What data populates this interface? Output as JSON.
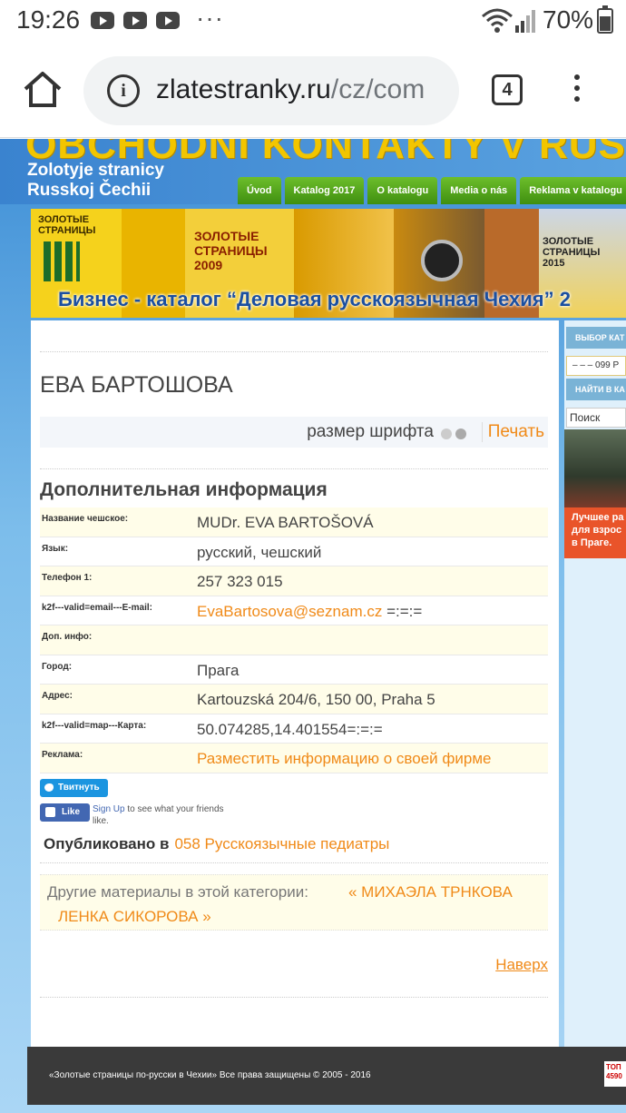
{
  "statusbar": {
    "time": "19:26",
    "notifications": [
      "youtube-icon",
      "youtube-icon",
      "youtube-icon"
    ],
    "more": "···",
    "battery": "70%"
  },
  "browser": {
    "url_domain": "zlatestranky.ru",
    "url_path": "/cz/com",
    "tab_count": "4"
  },
  "site": {
    "header_title": "OBCHODNÍ KONTAKTY V RUSTINĚ V",
    "subtitle_line1": "Zolotyje stranicy",
    "subtitle_line2": "Russkoj Čechii",
    "nav": [
      "Úvod",
      "Katalog 2017",
      "O katalogu",
      "Media o nás",
      "Reklama v katalogu"
    ],
    "banner_text": "Бизнес - каталог “Деловая русскоязычная Чехия” 2",
    "banner_book_labels": [
      "ЗОЛОТЫЕ СТРАНИЦЫ",
      "ЗОЛОТЫЕ СТРАНИЦЫ 2009",
      "ЗОЛОТЫЕ СТРАНИЦЫ 2015"
    ]
  },
  "article": {
    "title": "ЕВА БАРТОШОВА",
    "font_size_label": "размер шрифта",
    "print_label": "Печать",
    "section_title": "Дополнительная информация",
    "fields": [
      {
        "label": "Название чешское:",
        "value": "MUDr. EVA BARTOŠOVÁ",
        "link": false,
        "suffix": ""
      },
      {
        "label": "Язык:",
        "value": "русский, чешский",
        "link": false,
        "suffix": ""
      },
      {
        "label": "Телефон 1:",
        "value": "257 323 015",
        "link": false,
        "suffix": ""
      },
      {
        "label": "k2f---valid=email---E-mail:",
        "value": "EvaBartosova@seznam.cz",
        "link": true,
        "suffix": " =:=:="
      },
      {
        "label": "Доп. инфо:",
        "value": "",
        "link": false,
        "suffix": ""
      },
      {
        "label": "Город:",
        "value": "Прага",
        "link": false,
        "suffix": ""
      },
      {
        "label": "Адрес:",
        "value": "Kartouzská 204/6, 150 00, Praha 5",
        "link": false,
        "suffix": ""
      },
      {
        "label": "k2f---valid=map---Карта:",
        "value": "50.074285,14.401554=:=:=",
        "link": false,
        "suffix": ""
      },
      {
        "label": "Реклама:",
        "value": "Разместить информацию о своей фирме",
        "link": true,
        "suffix": ""
      }
    ],
    "tweet_label": "Твитнуть",
    "like_label": "Like",
    "like_signup": "Sign Up",
    "like_text": " to see what your friends like.",
    "published_label": "Опубликовано в",
    "published_category": "058 Русскоязычные педиатры",
    "other_label": "Другие материалы в этой категории:",
    "prev_item": "« МИХАЭЛА ТРНКОВА",
    "next_item": "ЛЕНКА СИКОРОВА »",
    "top_link": "Наверх"
  },
  "sidebar": {
    "catalog_heading": "ВЫБОР КАТ",
    "catalog_select": "– – – 099 Р",
    "search_heading": "НАЙТИ В КА",
    "search_placeholder": "Поиск",
    "ad_text": "Лучшее ра для взрос в Праге."
  },
  "footer": {
    "copyright": "«Золотые страницы по-русски в Чехии» Все права защищены © 2005 - 2016",
    "badge": "ТОП 4590"
  },
  "colors": {
    "accent_link": "#f08a18",
    "nav_green": "#4f9f19",
    "header_blue": "#3a83cf",
    "title_gold": "#f2c500"
  }
}
